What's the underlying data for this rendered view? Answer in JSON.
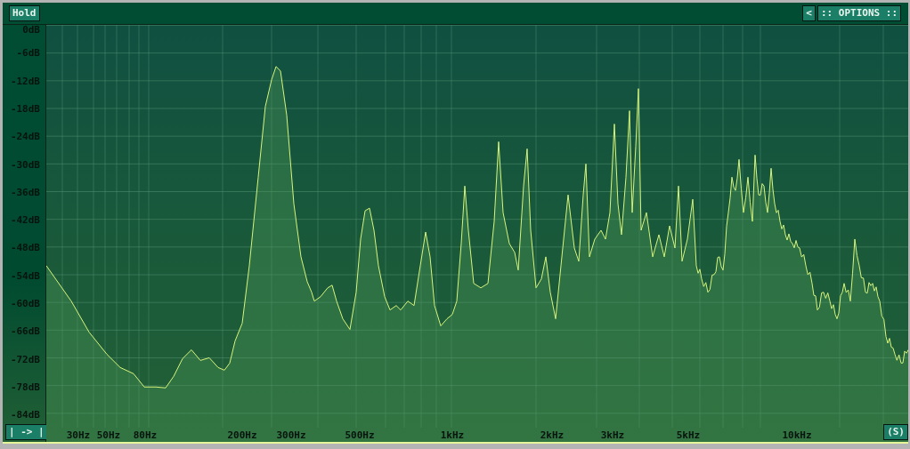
{
  "toolbar": {
    "hold_button": "Hold",
    "options_toggle": "<",
    "options_button": ":: OPTIONS ::"
  },
  "spectrum": {
    "db_labels": [
      "0dB",
      "-6dB",
      "-12dB",
      "-18dB",
      "-24dB",
      "-30dB",
      "-36dB",
      "-42dB",
      "-48dB",
      "-54dB",
      "-60dB",
      "-66dB",
      "-72dB",
      "-78dB",
      "-84dB"
    ],
    "freq_labels": [
      "30Hz",
      "50Hz",
      "80Hz",
      "200Hz",
      "300Hz",
      "500Hz",
      "1kHz",
      "2kHz",
      "3kHz",
      "5kHz",
      "10kHz"
    ],
    "range_button": "| -> |",
    "scale_button": "(S)"
  }
}
